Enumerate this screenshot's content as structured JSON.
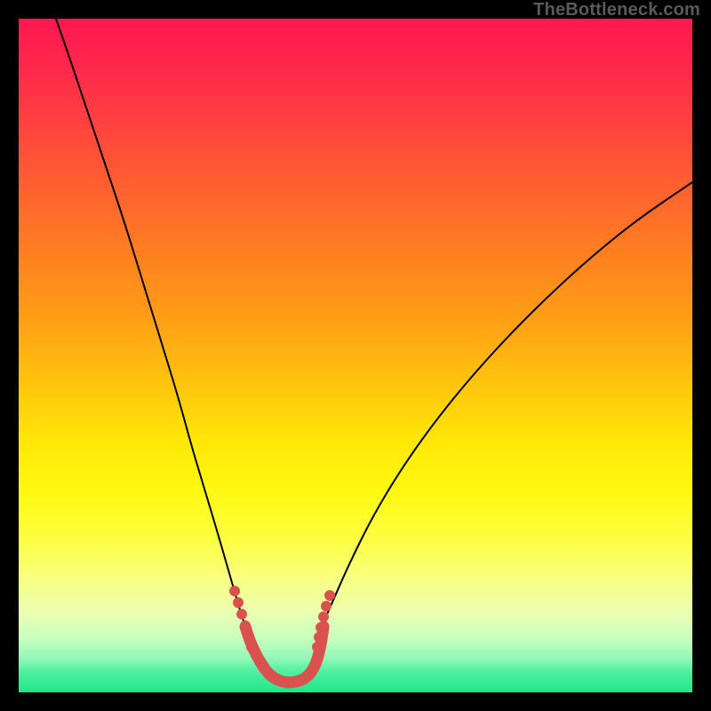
{
  "watermark": "TheBottleneck.com",
  "chart_data": {
    "type": "line",
    "title": "",
    "xlabel": "",
    "ylabel": "",
    "xlim": [
      21,
      779
    ],
    "ylim": [
      21,
      779
    ],
    "series": [
      {
        "name": "curve-left",
        "stroke": "#000000",
        "stroke_width": 2,
        "points": [
          [
            63,
            21
          ],
          [
            80,
            70
          ],
          [
            100,
            130
          ],
          [
            120,
            190
          ],
          [
            140,
            250
          ],
          [
            160,
            315
          ],
          [
            180,
            380
          ],
          [
            200,
            445
          ],
          [
            215,
            500
          ],
          [
            230,
            550
          ],
          [
            245,
            600
          ],
          [
            258,
            645
          ],
          [
            268,
            680
          ],
          [
            276,
            705
          ]
        ]
      },
      {
        "name": "curve-right",
        "stroke": "#000000",
        "stroke_width": 2,
        "points": [
          [
            362,
            705
          ],
          [
            375,
            675
          ],
          [
            395,
            630
          ],
          [
            420,
            580
          ],
          [
            450,
            530
          ],
          [
            485,
            480
          ],
          [
            525,
            430
          ],
          [
            570,
            380
          ],
          [
            620,
            330
          ],
          [
            670,
            285
          ],
          [
            720,
            245
          ],
          [
            779,
            205
          ]
        ]
      },
      {
        "name": "highlight-bottom",
        "stroke": "#d9524e",
        "stroke_width": 13,
        "linecap": "round",
        "points": [
          [
            276,
            705
          ],
          [
            280,
            718
          ],
          [
            285,
            730
          ],
          [
            290,
            740
          ],
          [
            296,
            750
          ],
          [
            302,
            758
          ],
          [
            310,
            764
          ],
          [
            318,
            767
          ],
          [
            326,
            768
          ],
          [
            334,
            767
          ],
          [
            342,
            764
          ],
          [
            349,
            758
          ],
          [
            355,
            748
          ],
          [
            359,
            735
          ],
          [
            362,
            720
          ],
          [
            364,
            705
          ]
        ]
      },
      {
        "name": "highlight-dots-left",
        "type_hint": "dots",
        "fill": "#d9524e",
        "r": 6,
        "points": [
          [
            264,
            665
          ],
          [
            268,
            678
          ],
          [
            272,
            691
          ],
          [
            276,
            704
          ],
          [
            280,
            717
          ],
          [
            283,
            728
          ]
        ]
      },
      {
        "name": "highlight-dots-right",
        "type_hint": "dots",
        "fill": "#d9524e",
        "r": 6,
        "points": [
          [
            357,
            728
          ],
          [
            359,
            717
          ],
          [
            361,
            706
          ],
          [
            364,
            694
          ],
          [
            367,
            682
          ],
          [
            371,
            670
          ]
        ]
      }
    ]
  }
}
